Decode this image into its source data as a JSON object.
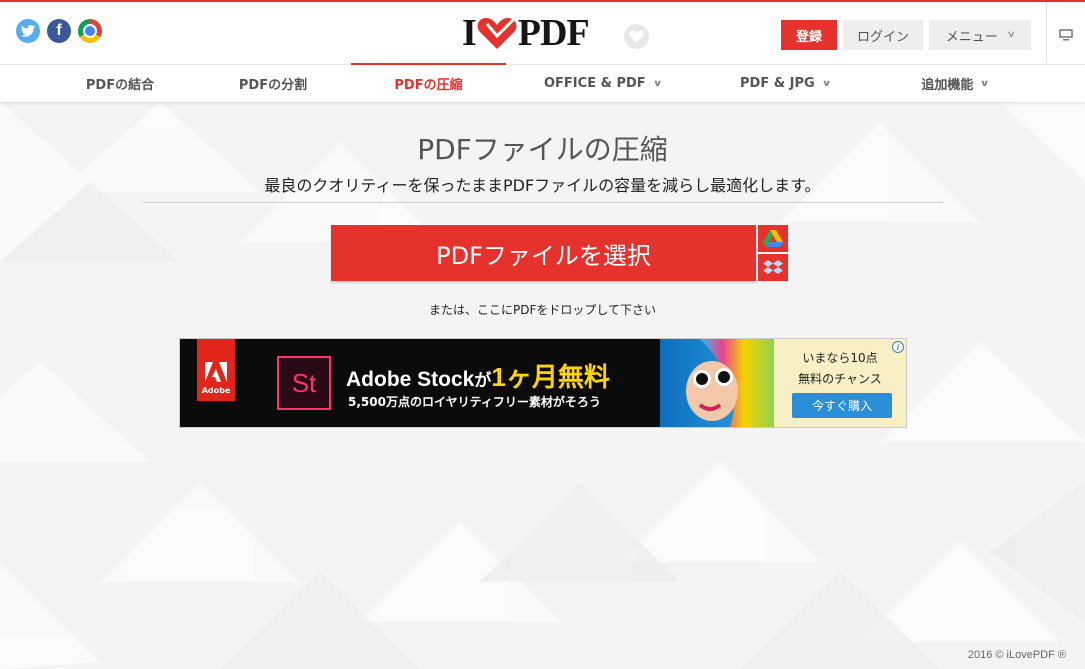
{
  "header": {
    "social": [
      "twitter-icon",
      "facebook-icon",
      "chrome-icon"
    ],
    "logo_left": "I",
    "logo_right": "PDF",
    "register_label": "登録",
    "login_label": "ログイン",
    "menu_label": "メニュー"
  },
  "nav": {
    "items": [
      {
        "label": "PDFの結合",
        "active": false,
        "dropdown": false
      },
      {
        "label": "PDFの分割",
        "active": false,
        "dropdown": false
      },
      {
        "label": "PDFの圧縮",
        "active": true,
        "dropdown": false
      },
      {
        "label": "OFFICE & PDF",
        "active": false,
        "dropdown": true
      },
      {
        "label": "PDF & JPG",
        "active": false,
        "dropdown": true
      },
      {
        "label": "追加機能",
        "active": false,
        "dropdown": true
      }
    ]
  },
  "main": {
    "title": "PDFファイルの圧縮",
    "subtitle": "最良のクオリティーを保ったままPDFファイルの容量を減らし最適化します。",
    "select_button": "PDFファイルを選択",
    "drop_hint": "または、ここにPDFをドロップして下さい"
  },
  "ad": {
    "adobe_label": "Adobe",
    "st_label": "St",
    "headline_brand": "Adobe Stock",
    "headline_particle": "が",
    "headline_offer": "1ヶ月無料",
    "sub": "5,500万点のロイヤリティフリー素材がそろう",
    "right_line1": "いまなら10点",
    "right_line2": "無料のチャンス",
    "buy_button": "今すぐ購入",
    "info": "i"
  },
  "footer": {
    "copyright": "2016 © iLovePDF ®"
  },
  "colors": {
    "brand_red": "#e5322d",
    "nav_text": "#555555",
    "ad_yellow": "#ffd400",
    "ad_button_blue": "#2a8ed9"
  }
}
